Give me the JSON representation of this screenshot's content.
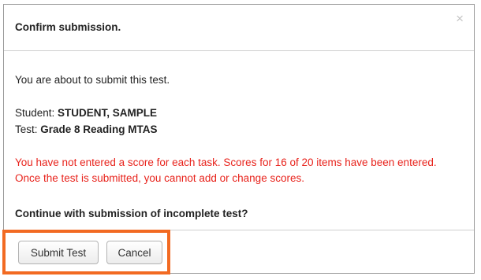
{
  "dialog": {
    "title": "Confirm submission.",
    "close_symbol": "×",
    "intro": "You are about to submit this test.",
    "student_label": "Student: ",
    "student_value": "STUDENT, SAMPLE",
    "test_label": "Test: ",
    "test_value": "Grade 8 Reading MTAS",
    "warning": "You have not entered a score for each task. Scores for 16 of 20 items have been entered. Once the test is submitted, you cannot add or change scores.",
    "question": "Continue with submission of incomplete test?",
    "buttons": {
      "submit": "Submit Test",
      "cancel": "Cancel"
    }
  },
  "colors": {
    "warning": "#e8231c",
    "highlight": "#f26a22"
  }
}
